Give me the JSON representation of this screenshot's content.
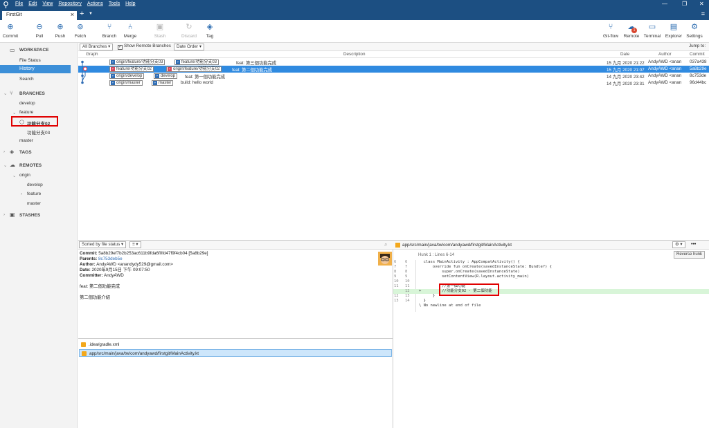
{
  "app": {
    "menu": [
      "File",
      "Edit",
      "View",
      "Repository",
      "Actions",
      "Tools",
      "Help"
    ],
    "tab_title": "FirstGit"
  },
  "toolbar": {
    "left": [
      "Commit",
      "Pull",
      "Push",
      "Fetch",
      "Branch",
      "Merge",
      "Stash",
      "Discard",
      "Tag"
    ],
    "right": [
      "Git-flow",
      "Remote",
      "Terminal",
      "Explorer",
      "Settings"
    ],
    "remote_badge": "1",
    "jump_to": "Jump to:"
  },
  "sidebar": {
    "workspace": "WORKSPACE",
    "file_status": "File Status",
    "history": "History",
    "search": "Search",
    "branches": "BRANCHES",
    "develop": "develop",
    "feature": "feature",
    "branch_sel": "功能分支02",
    "branch2": "功能分支03",
    "master": "master",
    "tags": "TAGS",
    "remotes": "REMOTES",
    "origin": "origin",
    "r_develop": "develop",
    "r_feature": "feature",
    "r_master": "master",
    "stashes": "STASHES"
  },
  "filter": {
    "branches": "All Branches",
    "show_remote": "Show Remote Branches",
    "order": "Date Order"
  },
  "log": {
    "headers": [
      "Graph",
      "Description",
      "Date",
      "Author",
      "Commit"
    ],
    "rows": [
      {
        "labels": [
          "origin/feature/功能分支03",
          "feature/功能分支03"
        ],
        "desc": "feat: 第三個功能完成",
        "date": "15 九月 2020 21:22",
        "author": "AndyAWD <anan",
        "commit": "037a438"
      },
      {
        "labels": [
          "feature/功能分支02",
          "origin/feature/功能分支02"
        ],
        "desc": "feat: 第二個功能完成",
        "date": "15 九月 2020 21:07",
        "author": "AndyAWD <anan",
        "commit": "5a8b29e"
      },
      {
        "labels": [
          "origin/develop",
          "develop"
        ],
        "desc": "feat: 第一個功能完成",
        "date": "14 九月 2020 23:42",
        "author": "AndyAWD <anan",
        "commit": "8c753de"
      },
      {
        "labels": [
          "origin/master",
          "master"
        ],
        "desc": "build: hello world",
        "date": "14 九月 2020 23:31",
        "author": "AndyAWD <anan",
        "commit": "96d44bc"
      }
    ]
  },
  "details": {
    "sort": "Sorted by file status",
    "commit_label": "Commit:",
    "commit": "5a8b29ef7b2b253ac611b9fda6f0fd47f9f4cb04 [5a8b29e]",
    "parents_label": "Parents:",
    "parents": "8c753deb5e",
    "author_label": "Author:",
    "author": "AndyAWD <anandydy529@gmail.com>",
    "date_label": "Date:",
    "date": "2020年9月15日 下午 09:07:50",
    "committer_label": "Committer:",
    "committer": "AndyAWD",
    "msg1": "feat: 第二個功能完成",
    "msg2": "第二個功能介紹",
    "files": [
      ".idea/gradle.xml",
      "app/src/main/java/tw/com/andyawd/firstgit/MainActivity.kt"
    ]
  },
  "diff": {
    "path": "app/src/main/java/tw/com/andyawd/firstgit/MainActivity.kt",
    "hunk": "Hunk 1 : Lines 6-14",
    "reverse": "Reverse hunk",
    "lines": [
      {
        "n1": "6",
        "n2": "6",
        "t": "  class MainActivity : AppCompatActivity() {",
        "k": ""
      },
      {
        "n1": "7",
        "n2": "7",
        "t": "      override fun onCreate(savedInstanceState: Bundle?) {",
        "k": ""
      },
      {
        "n1": "8",
        "n2": "8",
        "t": "          super.onCreate(savedInstanceState)",
        "k": ""
      },
      {
        "n1": "9",
        "n2": "9",
        "t": "          setContentView(R.layout.activity_main)",
        "k": ""
      },
      {
        "n1": "10",
        "n2": "10",
        "t": "",
        "k": ""
      },
      {
        "n1": "11",
        "n2": "11",
        "t": "          //第一個功能",
        "k": ""
      },
      {
        "n1": "",
        "n2": "12",
        "t": "+         //功能分支02 - 第二個功能",
        "k": "add"
      },
      {
        "n1": "12",
        "n2": "13",
        "t": "      }",
        "k": ""
      },
      {
        "n1": "13",
        "n2": "14",
        "t": "  }",
        "k": ""
      },
      {
        "n1": "",
        "n2": "",
        "t": "\\ No newline at end of file",
        "k": ""
      }
    ]
  }
}
